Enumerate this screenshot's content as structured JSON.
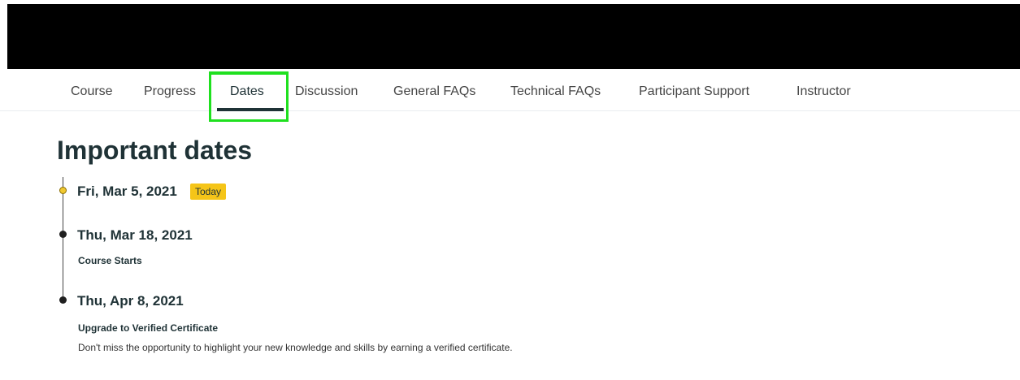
{
  "nav": {
    "tabs": [
      {
        "label": "Course"
      },
      {
        "label": "Progress"
      },
      {
        "label": "Dates"
      },
      {
        "label": "Discussion"
      },
      {
        "label": "General FAQs"
      },
      {
        "label": "Technical FAQs"
      },
      {
        "label": "Participant Support"
      },
      {
        "label": "Instructor"
      }
    ],
    "active_tab": "Dates"
  },
  "page": {
    "title": "Important dates"
  },
  "timeline": {
    "items": [
      {
        "date": "Fri, Mar 5, 2021",
        "badge": "Today"
      },
      {
        "date": "Thu, Mar 18, 2021",
        "title": "Course Starts"
      },
      {
        "date": "Thu, Apr 8, 2021",
        "title": "Upgrade to Verified Certificate",
        "description": "Don't miss the opportunity to highlight your new knowledge and skills by earning a verified certificate."
      }
    ]
  },
  "colors": {
    "highlight": "#1fe01f",
    "today_badge": "#f5c518",
    "text": "#1f3236"
  }
}
